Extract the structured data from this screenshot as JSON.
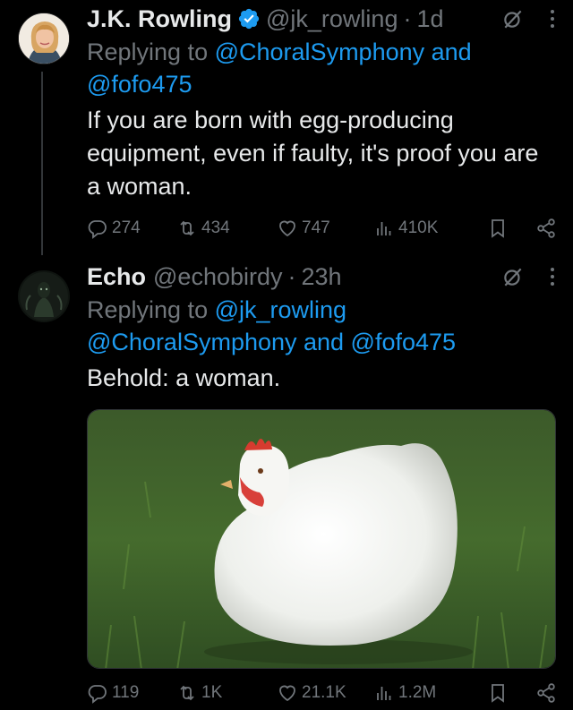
{
  "tweets": [
    {
      "author_name": "J.K. Rowling",
      "handle": "@jk_rowling",
      "separator": "·",
      "time": "1d",
      "replying_prefix": "Replying to",
      "replying_line1": "@ChoralSymphony and",
      "replying_line2": "@fofo475",
      "text": "If you are born with egg-producing equipment, even if faulty, it's proof you are a woman.",
      "replies": "274",
      "reposts": "434",
      "likes": "747",
      "views": "410K"
    },
    {
      "author_name": "Echo",
      "handle": "@echobirdy",
      "separator": "·",
      "time": "23h",
      "replying_prefix": "Replying to",
      "replying_line1": "@jk_rowling",
      "replying_line2": "@ChoralSymphony and @fofo475",
      "text": "Behold: a woman.",
      "replies": "119",
      "reposts": "1K",
      "likes": "21.1K",
      "views": "1.2M"
    }
  ],
  "colors": {
    "background": "#000000",
    "text": "#e7e9ea",
    "muted": "#71767b",
    "link": "#1d9bf0",
    "verified": "#1d9bf0"
  },
  "icons": [
    "verified-badge-icon",
    "grok-icon",
    "more-icon",
    "reply-icon",
    "repost-icon",
    "like-icon",
    "views-icon",
    "bookmark-icon",
    "share-icon"
  ]
}
